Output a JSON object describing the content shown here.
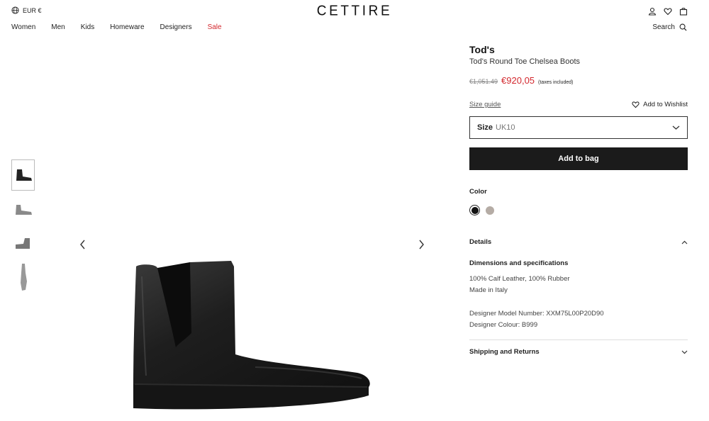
{
  "header": {
    "currency": "EUR €",
    "logo": "CETTIRE",
    "nav": [
      "Women",
      "Men",
      "Kids",
      "Homeware",
      "Designers",
      "Sale"
    ],
    "search_label": "Search"
  },
  "product": {
    "brand": "Tod's",
    "name": "Tod's Round Toe Chelsea Boots",
    "old_price": "€1,051.49",
    "new_price": "€920,05",
    "tax_note": "(taxes included)",
    "size_guide": "Size guide",
    "wishlist": "Add to Wishlist",
    "size_label": "Size",
    "size_value": "UK10",
    "add_to_bag": "Add to bag",
    "color_label": "Color",
    "colors": [
      "#111111",
      "#b5aca5"
    ]
  },
  "details": {
    "title": "Details",
    "dimensions_title": "Dimensions and specifications",
    "line1": "100% Calf Leather, 100% Rubber",
    "line2": "Made in Italy",
    "line3": "Designer Model Number: XXM75L00P20D90",
    "line4": "Designer Colour: B999",
    "shipping": "Shipping and Returns"
  },
  "colors": {
    "sale": "#d3272d",
    "button": "#1b1b1b"
  }
}
